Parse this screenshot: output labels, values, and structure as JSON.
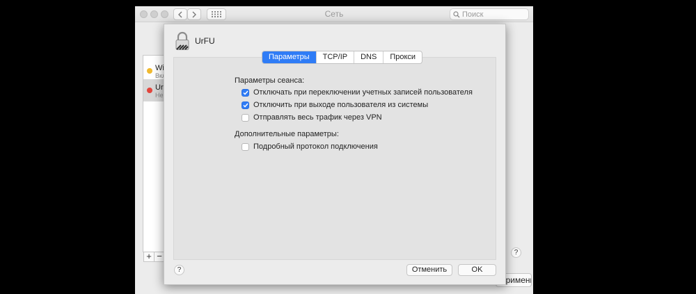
{
  "window": {
    "title": "Сеть"
  },
  "search": {
    "placeholder": "Поиск"
  },
  "services": [
    {
      "name": "Wi",
      "status": "Вкл",
      "status_color": "#f0b930"
    },
    {
      "name": "Ur",
      "status": "Не",
      "status_color": "#e2453c"
    }
  ],
  "list_controls": {
    "add": "+",
    "remove": "−"
  },
  "help_label": "?",
  "main_window": {
    "apply_label": "Применить"
  },
  "sheet": {
    "title": "UrFU",
    "tabs": [
      "Параметры",
      "TCP/IP",
      "DNS",
      "Прокси"
    ],
    "active_tab": "Параметры",
    "session_section_label": "Параметры сеанса:",
    "session_options": [
      {
        "label": "Отключать при переключении учетных записей пользователя",
        "checked": true
      },
      {
        "label": "Отключить при выходе пользователя из системы",
        "checked": true
      },
      {
        "label": "Отправлять весь трафик через VPN",
        "checked": false
      }
    ],
    "advanced_section_label": "Дополнительные параметры:",
    "advanced_options": [
      {
        "label": "Подробный протокол подключения",
        "checked": false
      }
    ],
    "cancel_label": "Отменить",
    "ok_label": "OK"
  },
  "colors": {
    "accent": "#2f7cf6"
  }
}
